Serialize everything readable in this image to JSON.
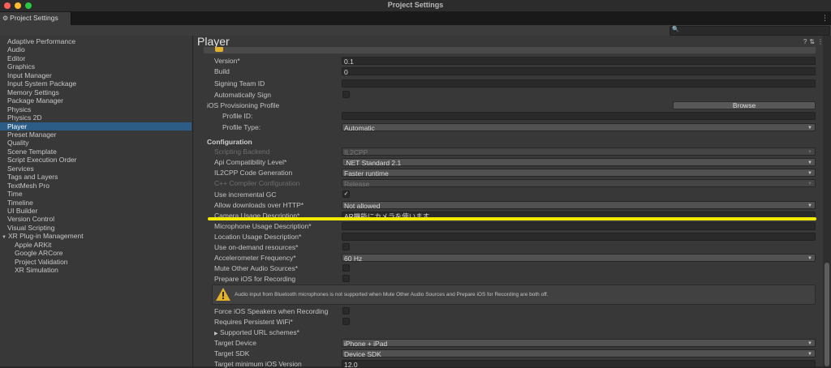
{
  "window": {
    "title": "Project Settings",
    "tab_label": "Project Settings"
  },
  "search": {
    "placeholder": ""
  },
  "sidebar": {
    "items": [
      {
        "label": "Adaptive Performance",
        "level": 0
      },
      {
        "label": "Audio",
        "level": 0
      },
      {
        "label": "Editor",
        "level": 0
      },
      {
        "label": "Graphics",
        "level": 0
      },
      {
        "label": "Input Manager",
        "level": 0
      },
      {
        "label": "Input System Package",
        "level": 0
      },
      {
        "label": "Memory Settings",
        "level": 0
      },
      {
        "label": "Package Manager",
        "level": 0
      },
      {
        "label": "Physics",
        "level": 0
      },
      {
        "label": "Physics 2D",
        "level": 0
      },
      {
        "label": "Player",
        "level": 0,
        "selected": true
      },
      {
        "label": "Preset Manager",
        "level": 0
      },
      {
        "label": "Quality",
        "level": 0
      },
      {
        "label": "Scene Template",
        "level": 0
      },
      {
        "label": "Script Execution Order",
        "level": 0
      },
      {
        "label": "Services",
        "level": 0
      },
      {
        "label": "Tags and Layers",
        "level": 0
      },
      {
        "label": "TextMesh Pro",
        "level": 0
      },
      {
        "label": "Time",
        "level": 0
      },
      {
        "label": "Timeline",
        "level": 0
      },
      {
        "label": "UI Builder",
        "level": 0
      },
      {
        "label": "Version Control",
        "level": 0
      },
      {
        "label": "Visual Scripting",
        "level": 0
      },
      {
        "label": "XR Plug-in Management",
        "level": 0,
        "expanded": true
      },
      {
        "label": "Apple ARKit",
        "level": 1
      },
      {
        "label": "Google ARCore",
        "level": 1
      },
      {
        "label": "Project Validation",
        "level": 1
      },
      {
        "label": "XR Simulation",
        "level": 1
      }
    ]
  },
  "player": {
    "title": "Player",
    "identification": {
      "version_label": "Version*",
      "version_value": "0.1",
      "build_label": "Build",
      "build_value": "0",
      "signing_team_label": "Signing Team ID",
      "signing_team_value": "",
      "auto_sign_label": "Automatically Sign",
      "provisioning_label": "iOS Provisioning Profile",
      "browse_label": "Browse",
      "profile_id_label": "Profile ID:",
      "profile_id_value": "",
      "profile_type_label": "Profile Type:",
      "profile_type_value": "Automatic"
    },
    "configuration": {
      "heading": "Configuration",
      "scripting_backend_label": "Scripting Backend",
      "scripting_backend_value": "IL2CPP",
      "api_compat_label": "Api Compatibility Level*",
      "api_compat_value": ".NET Standard 2.1",
      "il2cpp_gen_label": "IL2CPP Code Generation",
      "il2cpp_gen_value": "Faster runtime",
      "cpp_compiler_label": "C++ Compiler Configuration",
      "cpp_compiler_value": "Release",
      "incremental_gc_label": "Use incremental GC",
      "incremental_gc_checked": true,
      "downloads_http_label": "Allow downloads over HTTP*",
      "downloads_http_value": "Not allowed",
      "camera_usage_label": "Camera Usage Description*",
      "camera_usage_value": "AR機能にカメラを使います。",
      "mic_usage_label": "Microphone Usage Description*",
      "mic_usage_value": "",
      "location_usage_label": "Location Usage Description*",
      "location_usage_value": "",
      "on_demand_label": "Use on-demand resources*",
      "accelerometer_label": "Accelerometer Frequency*",
      "accelerometer_value": "60 Hz",
      "mute_audio_label": "Mute Other Audio Sources*",
      "prepare_ios_label": "Prepare iOS for Recording",
      "help_text": "Audio input from Bluetooth microphones is not supported when Mute Other Audio Sources and Prepare iOS for Recording are both off.",
      "force_speakers_label": "Force iOS Speakers when Recording",
      "persistent_wifi_label": "Requires Persistent WiFi*",
      "url_schemes_label": "Supported URL schemes*",
      "target_device_label": "Target Device",
      "target_device_value": "iPhone + iPad",
      "target_sdk_label": "Target SDK",
      "target_sdk_value": "Device SDK",
      "target_min_ios_label": "Target minimum iOS Version",
      "target_min_ios_value": "12.0"
    }
  },
  "colors": {
    "selection": "#2c5d87",
    "highlight_line": "#f2ea00",
    "warning": "#e2b12b"
  },
  "icons": [
    "gear-icon",
    "search-icon",
    "help-icon",
    "presets-icon",
    "more-icon",
    "warning-icon",
    "checkmark-icon",
    "chevron-down-icon",
    "triangle-right-icon"
  ]
}
